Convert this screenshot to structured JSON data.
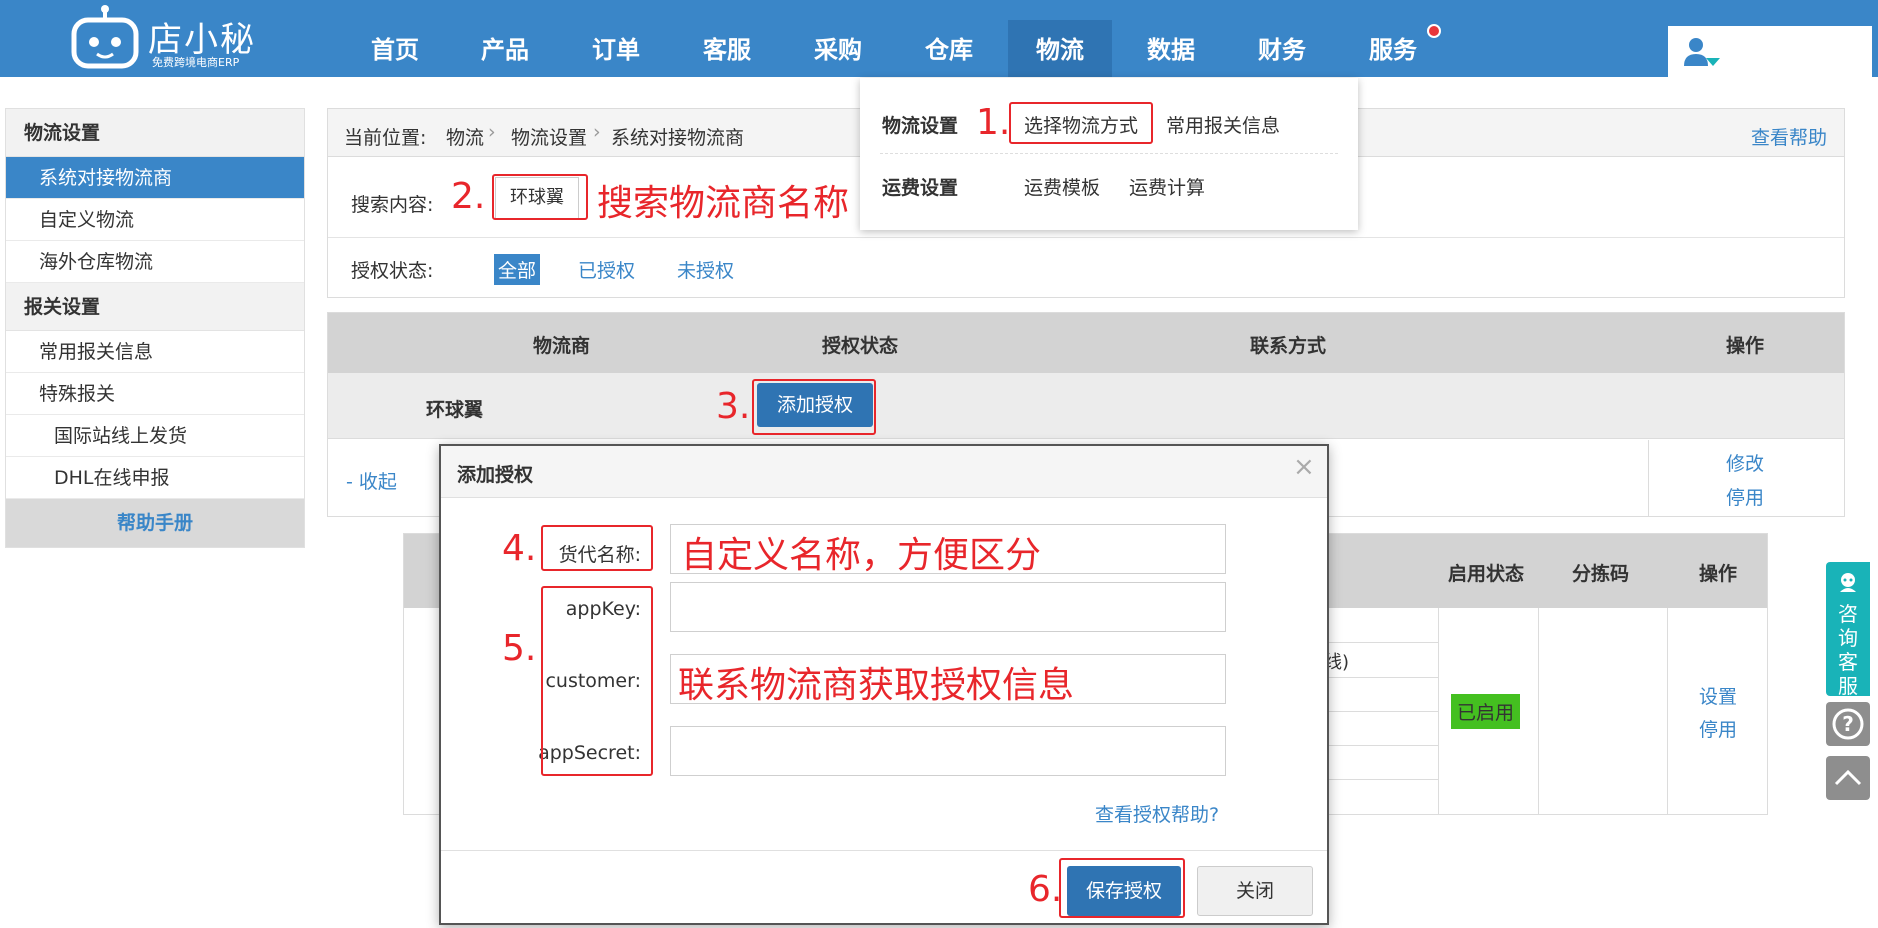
{
  "header": {
    "brand": "店小秘",
    "slogan": "免费跨境电商ERP",
    "nav": [
      "首页",
      "产品",
      "订单",
      "客服",
      "采购",
      "仓库",
      "物流",
      "数据",
      "财务",
      "服务"
    ],
    "active_nav": "物流"
  },
  "dropdown": {
    "group1_title": "物流设置",
    "group1_items": [
      "选择物流方式",
      "常用报关信息"
    ],
    "group2_title": "运费设置",
    "group2_items": [
      "运费模板",
      "运费计算"
    ]
  },
  "sidebar": {
    "group1": "物流设置",
    "items1": [
      "系统对接物流商",
      "自定义物流",
      "海外仓库物流"
    ],
    "group2": "报关设置",
    "items2": [
      "常用报关信息",
      "特殊报关"
    ],
    "items2_sub": [
      "国际站线上发货",
      "DHL在线申报"
    ],
    "help": "帮助手册"
  },
  "breadcrumb": {
    "prefix": "当前位置:",
    "level1": "物流",
    "level2": "物流设置",
    "level3": "系统对接物流商",
    "help_link": "查看帮助"
  },
  "search": {
    "label": "搜索内容:",
    "value": "环球翼",
    "status_label": "授权状态:",
    "status_options": [
      "全部",
      "已授权",
      "未授权"
    ]
  },
  "table": {
    "headers": [
      "物流商",
      "授权状态",
      "联系方式",
      "操作"
    ],
    "row_provider": "环球翼",
    "add_auth_button": "添加授权",
    "collapse_link": "- 收起",
    "row_actions": [
      "修改",
      "停用"
    ]
  },
  "subtable": {
    "headers": [
      "启用状态",
      "分拣码",
      "操作"
    ],
    "cell_fragment": "线)",
    "status_badge": "已启用",
    "actions": [
      "设置",
      "停用"
    ]
  },
  "modal": {
    "title": "添加授权",
    "close": "×",
    "labels": [
      "货代名称:",
      "appKey:",
      "customer:",
      "appSecret:"
    ],
    "help_link": "查看授权帮助?",
    "save_button": "保存授权",
    "close_button": "关闭"
  },
  "annotations": {
    "steps": [
      "1.",
      "2.",
      "3.",
      "4.",
      "5.",
      "6."
    ],
    "note_search": "搜索物流商名称",
    "note_name": "自定义名称，方便区分",
    "note_auth": "联系物流商获取授权信息"
  },
  "floating": {
    "consult": "咨询客服",
    "help_icon": "question-icon",
    "top_icon": "chevron-up-icon"
  },
  "colors": {
    "primary": "#3a86c8",
    "annotation_red": "#e8262b",
    "enabled_green": "#44c020"
  }
}
